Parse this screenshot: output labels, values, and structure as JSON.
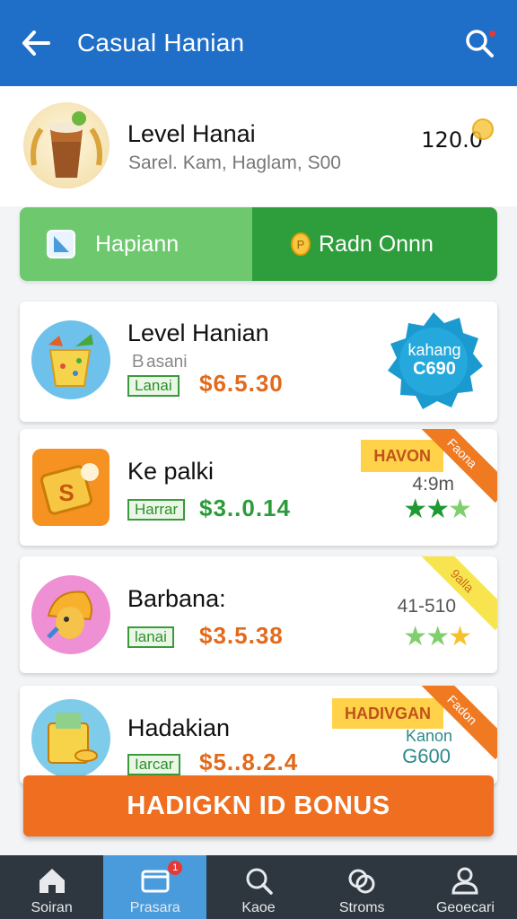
{
  "appbar": {
    "title": "Casual Hanian"
  },
  "header": {
    "level": "Level Hanai",
    "subtitle": "Sarel. Kam, Haglam, S00",
    "coins": "120.0"
  },
  "tabs": [
    {
      "label": "Hapiann"
    },
    {
      "label": "Radn Onnn"
    }
  ],
  "items": [
    {
      "name": "Level Hanian",
      "desc": "Ｂasani",
      "tag": "Lanai",
      "price": "$6.5.30",
      "badge_line1": "kahang",
      "badge_line2": "C690"
    },
    {
      "name": "Ke palki",
      "tag": "Harrar",
      "price": "$3..0.14",
      "ribbon": "HAVON",
      "corner": "Faona",
      "rating": "4:9m",
      "stars": "★★★"
    },
    {
      "name": "Barbana:",
      "tag": "lanai",
      "price": "$3.5.38",
      "corner": "9alla",
      "rating": "41-510",
      "stars": "★★★"
    },
    {
      "name": "Hadakian",
      "tag": "Iarcar",
      "price": "$5..8.2.4",
      "ribbon": "HADIVGAN",
      "corner": "Fadon",
      "extra_line1": "Kanon",
      "extra_line2": "G600"
    }
  ],
  "bonus_label": "HADIGKN ID BONUS",
  "nav": [
    {
      "label": "Soiran",
      "icon": "home-icon"
    },
    {
      "label": "Prasara",
      "icon": "cards-icon",
      "badge": "1"
    },
    {
      "label": "Kaoe",
      "icon": "search-icon"
    },
    {
      "label": "Stroms",
      "icon": "coins-icon"
    },
    {
      "label": "Geoecari",
      "icon": "profile-icon"
    }
  ],
  "colors": {
    "primary": "#1f6fc9",
    "tab_light": "#6dc86e",
    "tab_dark": "#2e9d3b",
    "bonus": "#ef6e1f",
    "nav_bg": "#2e3740",
    "nav_active": "#4a9bdc"
  }
}
